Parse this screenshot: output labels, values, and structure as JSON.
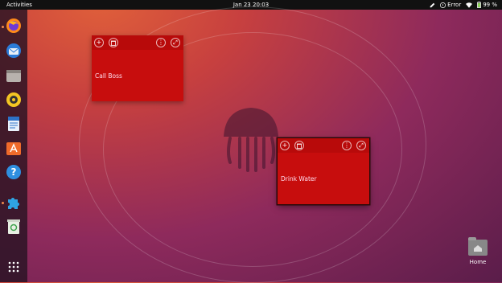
{
  "topbar": {
    "activities": "Activities",
    "clock": "Jan 23  20:03",
    "error_label": "Error",
    "battery": "99 %"
  },
  "dock": {
    "items": [
      {
        "name": "firefox",
        "icon": "firefox-icon"
      },
      {
        "name": "thunderbird",
        "icon": "thunderbird-icon"
      },
      {
        "name": "files",
        "icon": "files-icon"
      },
      {
        "name": "rhythmbox",
        "icon": "rhythmbox-icon"
      },
      {
        "name": "writer",
        "icon": "libreoffice-writer-icon"
      },
      {
        "name": "software",
        "icon": "ubuntu-software-icon"
      },
      {
        "name": "help",
        "icon": "help-icon"
      },
      {
        "name": "extension",
        "icon": "puzzle-icon"
      },
      {
        "name": "trash",
        "icon": "trash-icon"
      },
      {
        "name": "apps",
        "icon": "show-apps-icon"
      }
    ]
  },
  "notes": [
    {
      "text": "Call Boss",
      "color": "#c70d0d"
    },
    {
      "text": "Drink Water",
      "color": "#c70d0d"
    }
  ],
  "desktop": {
    "home_label": "Home"
  }
}
